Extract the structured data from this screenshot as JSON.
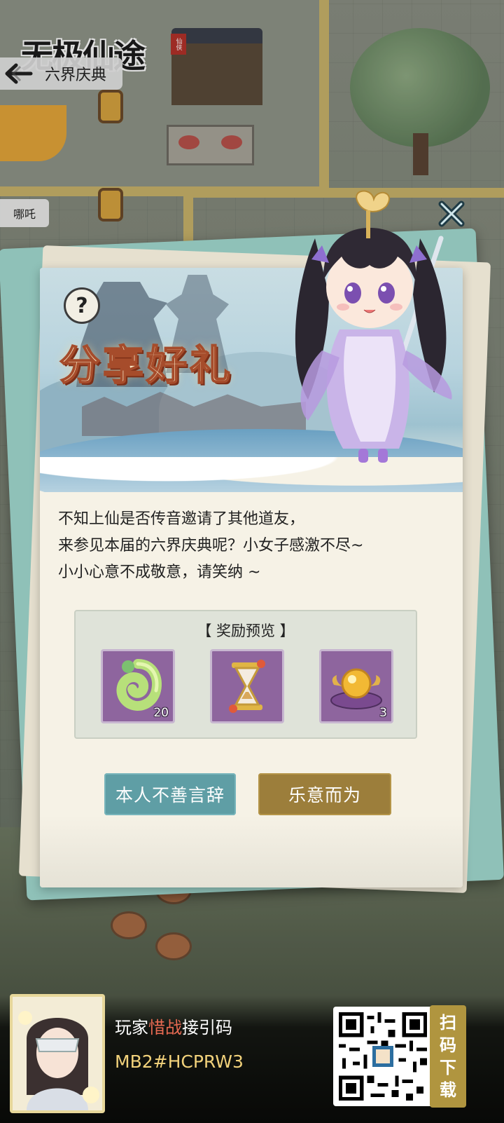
{
  "header": {
    "game_logo": "无极仙途",
    "logo_seal": "仙侠",
    "page_title": "六界庆典",
    "npc_name": "哪吒"
  },
  "dialog": {
    "banner_title": "分享好礼",
    "message_lines": [
      "不知上仙是否传音邀请了其他道友，",
      "来参见本届的六界庆典呢？小女子感激不尽~",
      "小小心意不成敬意，请笑纳 ~"
    ],
    "rewards_title": "【 奖励预览 】",
    "rewards": [
      {
        "icon": "jade-ring-icon",
        "count": "20"
      },
      {
        "icon": "hourglass-icon",
        "count": ""
      },
      {
        "icon": "golden-orb-cushion-icon",
        "count": "3"
      }
    ],
    "decline_label": "本人不善言辞",
    "accept_label": "乐意而为"
  },
  "promo": {
    "line1_prefix": "玩家",
    "line1_name": "惜战",
    "line1_suffix": "接引码",
    "code": "MB2#HCPRW3",
    "scan_label": [
      "扫",
      "码",
      "下",
      "载"
    ]
  },
  "colors": {
    "decline_button": "#5f9ea5",
    "accept_button": "#9c7e3b",
    "reward_slot": "#8e659e",
    "highlight_name": "#e86a52",
    "promo_code": "#f2d27b"
  }
}
